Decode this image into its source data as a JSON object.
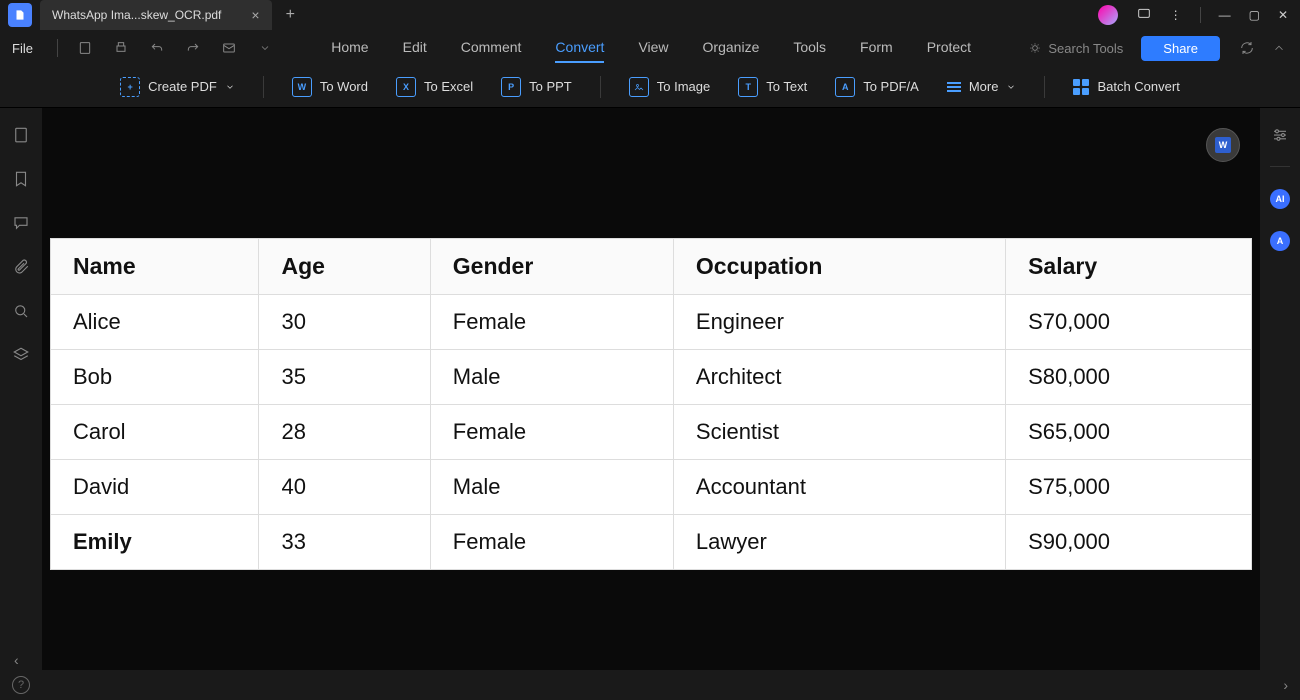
{
  "titlebar": {
    "tab_name": "WhatsApp Ima...skew_OCR.pdf"
  },
  "menubar": {
    "file": "File",
    "tabs": [
      "Home",
      "Edit",
      "Comment",
      "Convert",
      "View",
      "Organize",
      "Tools",
      "Form",
      "Protect"
    ],
    "active_tab": "Convert",
    "search_placeholder": "Search Tools",
    "share": "Share"
  },
  "toolbar": {
    "create_pdf": "Create PDF",
    "to_word": "To Word",
    "to_excel": "To Excel",
    "to_ppt": "To PPT",
    "to_image": "To Image",
    "to_text": "To Text",
    "to_pdfa": "To PDF/A",
    "more": "More",
    "batch": "Batch Convert"
  },
  "document": {
    "headers": [
      "Name",
      "Age",
      "Gender",
      "Occupation",
      "Salary"
    ],
    "rows": [
      {
        "name": "Alice",
        "age": "30",
        "gender": "Female",
        "occupation": "Engineer",
        "salary": "S70,000"
      },
      {
        "name": "Bob",
        "age": "35",
        "gender": "Male",
        "occupation": "Architect",
        "salary": "S80,000"
      },
      {
        "name": "Carol",
        "age": "28",
        "gender": "Female",
        "occupation": "Scientist",
        "salary": "S65,000"
      },
      {
        "name": "David",
        "age": "40",
        "gender": "Male",
        "occupation": "Accountant",
        "salary": "S75,000"
      },
      {
        "name": "Emily",
        "age": "33",
        "gender": "Female",
        "occupation": "Lawyer",
        "salary": "S90,000"
      }
    ]
  }
}
